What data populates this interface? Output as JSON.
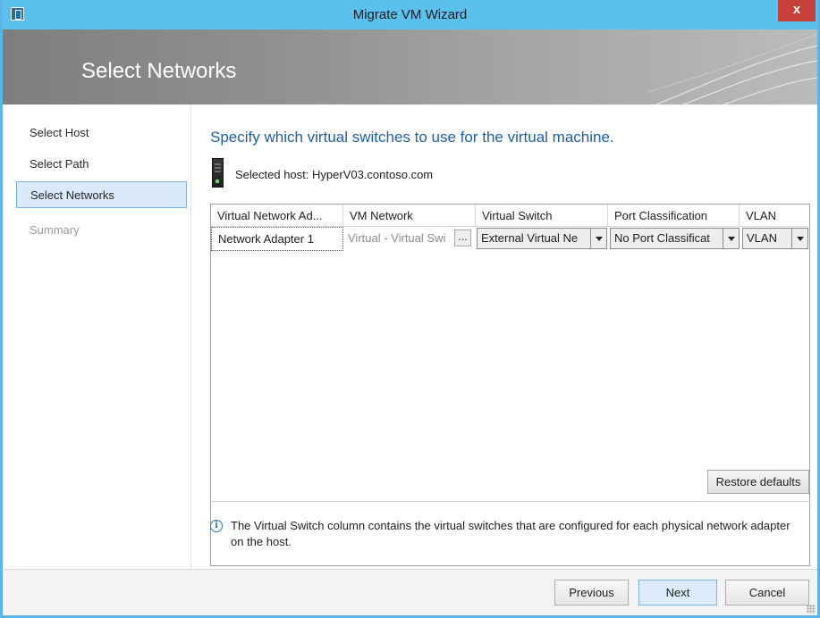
{
  "window": {
    "title": "Migrate VM Wizard",
    "close_label": "x"
  },
  "banner": {
    "title": "Select Networks"
  },
  "sidebar": {
    "items": [
      {
        "label": "Select Host",
        "state": "normal"
      },
      {
        "label": "Select Path",
        "state": "normal"
      },
      {
        "label": "Select Networks",
        "state": "active"
      },
      {
        "label": "Summary",
        "state": "disabled"
      }
    ]
  },
  "main": {
    "heading": "Specify which virtual switches to use for the virtual machine.",
    "host_label": "Selected host:",
    "host_value": "HyperV03.contoso.com",
    "table": {
      "columns": [
        "Virtual Network Ad...",
        "VM Network",
        "Virtual Switch",
        "Port Classification",
        "VLAN"
      ],
      "rows": [
        {
          "adapter": "Network Adapter 1",
          "vm_network": "Virtual - Virtual Swi",
          "virtual_switch": "External Virtual Ne",
          "port_classification": "No Port Classificat",
          "vlan": "VLAN"
        }
      ]
    },
    "restore_label": "Restore defaults",
    "info_text": "The Virtual Switch column contains the virtual switches that are configured for each physical network adapter on the host."
  },
  "footer": {
    "previous": "Previous",
    "next": "Next",
    "cancel": "Cancel"
  },
  "colors": {
    "titlebar": "#5ac0ee",
    "accent": "#1f5fa8",
    "close": "#c7403a"
  }
}
